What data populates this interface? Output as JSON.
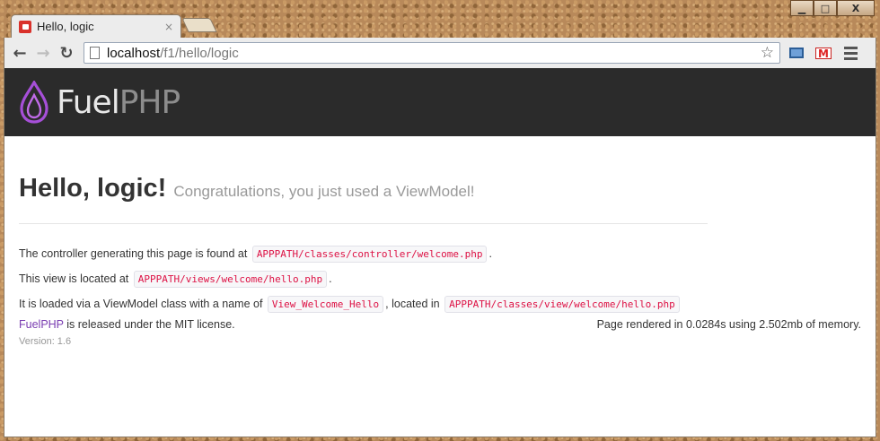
{
  "window": {
    "controls": {
      "minimize": "▁",
      "maximize": "□",
      "close": "X"
    }
  },
  "tab": {
    "title": "Hello, logic",
    "close": "×"
  },
  "toolbar": {
    "back": "←",
    "forward": "→",
    "reload": "↻",
    "url_host": "localhost",
    "url_path": "/f1/hello/logic",
    "star": "☆",
    "gmail_label": "M"
  },
  "page": {
    "logo": {
      "fuel": "Fuel",
      "php": "PHP",
      "drop_color": "#a64fd8"
    },
    "heading": "Hello, logic!",
    "subtitle": "Congratulations, you just used a ViewModel!",
    "lines": [
      {
        "prefix": "The controller generating this page is found at",
        "code": "APPPATH/classes/controller/welcome.php",
        "suffix": "."
      },
      {
        "prefix": "This view is located at",
        "code": "APPPATH/views/welcome/hello.php",
        "suffix": "."
      },
      {
        "prefix": "It is loaded via a ViewModel class with a name of",
        "code": "View_Welcome_Hello",
        "middle": ", located in",
        "code2": "APPPATH/classes/view/welcome/hello.php"
      }
    ],
    "footer": {
      "link": "FuelPHP",
      "license": " is released under the MIT license.",
      "rendered": "Page rendered in 0.0284s using 2.502mb of memory.",
      "version": "Version: 1.6"
    }
  }
}
